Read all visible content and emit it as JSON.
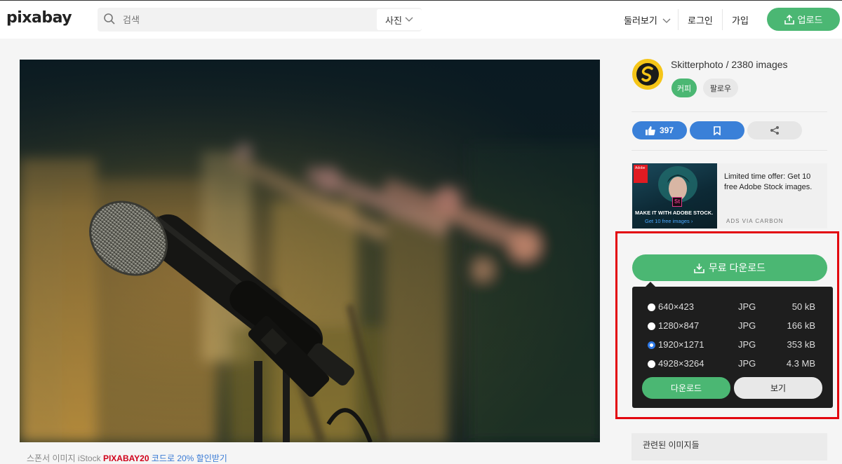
{
  "header": {
    "logo": "pixabay",
    "search_placeholder": "검색",
    "search_type": "사진",
    "explore": "둘러보기",
    "login": "로그인",
    "join": "가입",
    "upload": "업로드"
  },
  "caption": {
    "prefix": "스폰서 이미지 iStock",
    "promo": "PIXABAY20",
    "suffix": "코드로 20% 할인받기"
  },
  "author": {
    "name": "Skitterphoto / 2380 images",
    "coffee": "커피",
    "follow": "팔로우"
  },
  "actions": {
    "likes": "397"
  },
  "ad": {
    "brand": "Adobe",
    "app_mark": "St",
    "headline": "MAKE IT WITH ADOBE STOCK.",
    "cta": "Get 10 free images ›",
    "text": "Limited time offer: Get 10 free Adobe Stock images.",
    "via": "ADS VIA CARBON"
  },
  "download": {
    "button": "무료 다운로드",
    "options": [
      {
        "resolution": "640×423",
        "format": "JPG",
        "size": "50 kB",
        "selected": false
      },
      {
        "resolution": "1280×847",
        "format": "JPG",
        "size": "166 kB",
        "selected": false
      },
      {
        "resolution": "1920×1271",
        "format": "JPG",
        "size": "353 kB",
        "selected": true
      },
      {
        "resolution": "4928×3264",
        "format": "JPG",
        "size": "4.3 MB",
        "selected": false
      }
    ],
    "download_label": "다운로드",
    "view_label": "보기"
  },
  "related": {
    "title": "관련된 이미지들"
  },
  "colors": {
    "accent": "#4bb773",
    "like": "#3a80d8",
    "highlight": "#e3060f",
    "promo": "#d0021b"
  }
}
